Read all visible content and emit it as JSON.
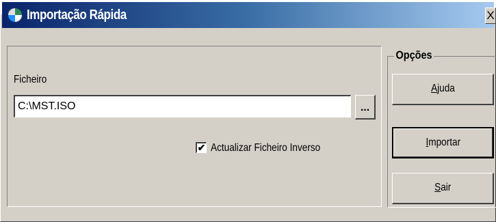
{
  "window": {
    "title": "Importação Rápida",
    "close_label": "X"
  },
  "form": {
    "file_label": "Ficheiro",
    "file_value": "C:\\MST.ISO",
    "browse_label": "...",
    "checkbox_label": "Actualizar Ficheiro Inverso",
    "checkbox_checked": true,
    "checkbox_mark": "✔"
  },
  "options": {
    "legend": "Opções",
    "buttons": [
      {
        "accel": "A",
        "rest": "juda"
      },
      {
        "accel": "I",
        "rest": "mportar"
      },
      {
        "accel": "S",
        "rest": "air"
      }
    ]
  },
  "colors": {
    "titlebar_start": "#0a246a",
    "titlebar_end": "#a6caf0",
    "face": "#d4d0c8"
  }
}
